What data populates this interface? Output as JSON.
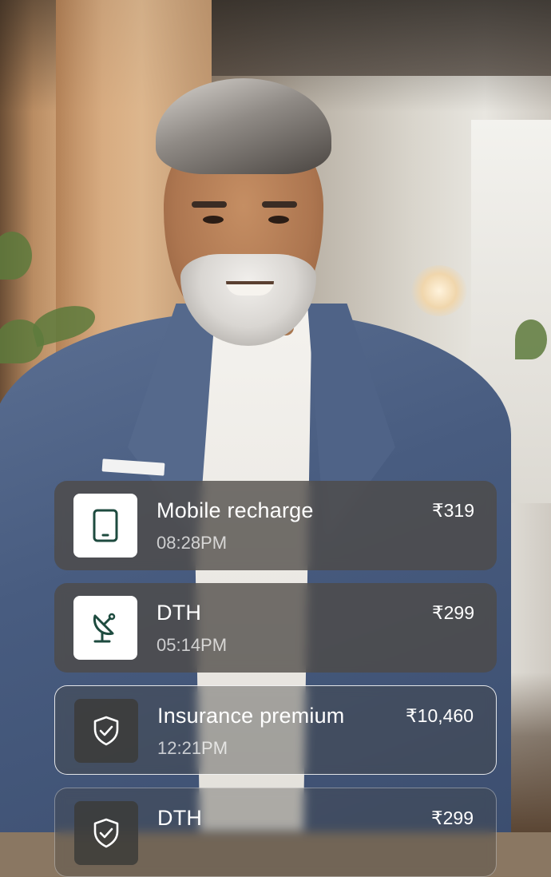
{
  "transactions": [
    {
      "title": "Mobile recharge",
      "time": "08:28PM",
      "amount": "₹319",
      "icon": "mobile-icon"
    },
    {
      "title": "DTH",
      "time": "05:14PM",
      "amount": "₹299",
      "icon": "satellite-dish-icon"
    },
    {
      "title": "Insurance premium",
      "time": "12:21PM",
      "amount": "₹10,460",
      "icon": "shield-check-icon"
    },
    {
      "title": "DTH",
      "time": "",
      "amount": "₹299",
      "icon": "shield-check-icon"
    }
  ],
  "colors": {
    "icon_dark_green": "#1e4b3f",
    "card_background": "#4e4a46",
    "text_primary": "#ffffff"
  }
}
